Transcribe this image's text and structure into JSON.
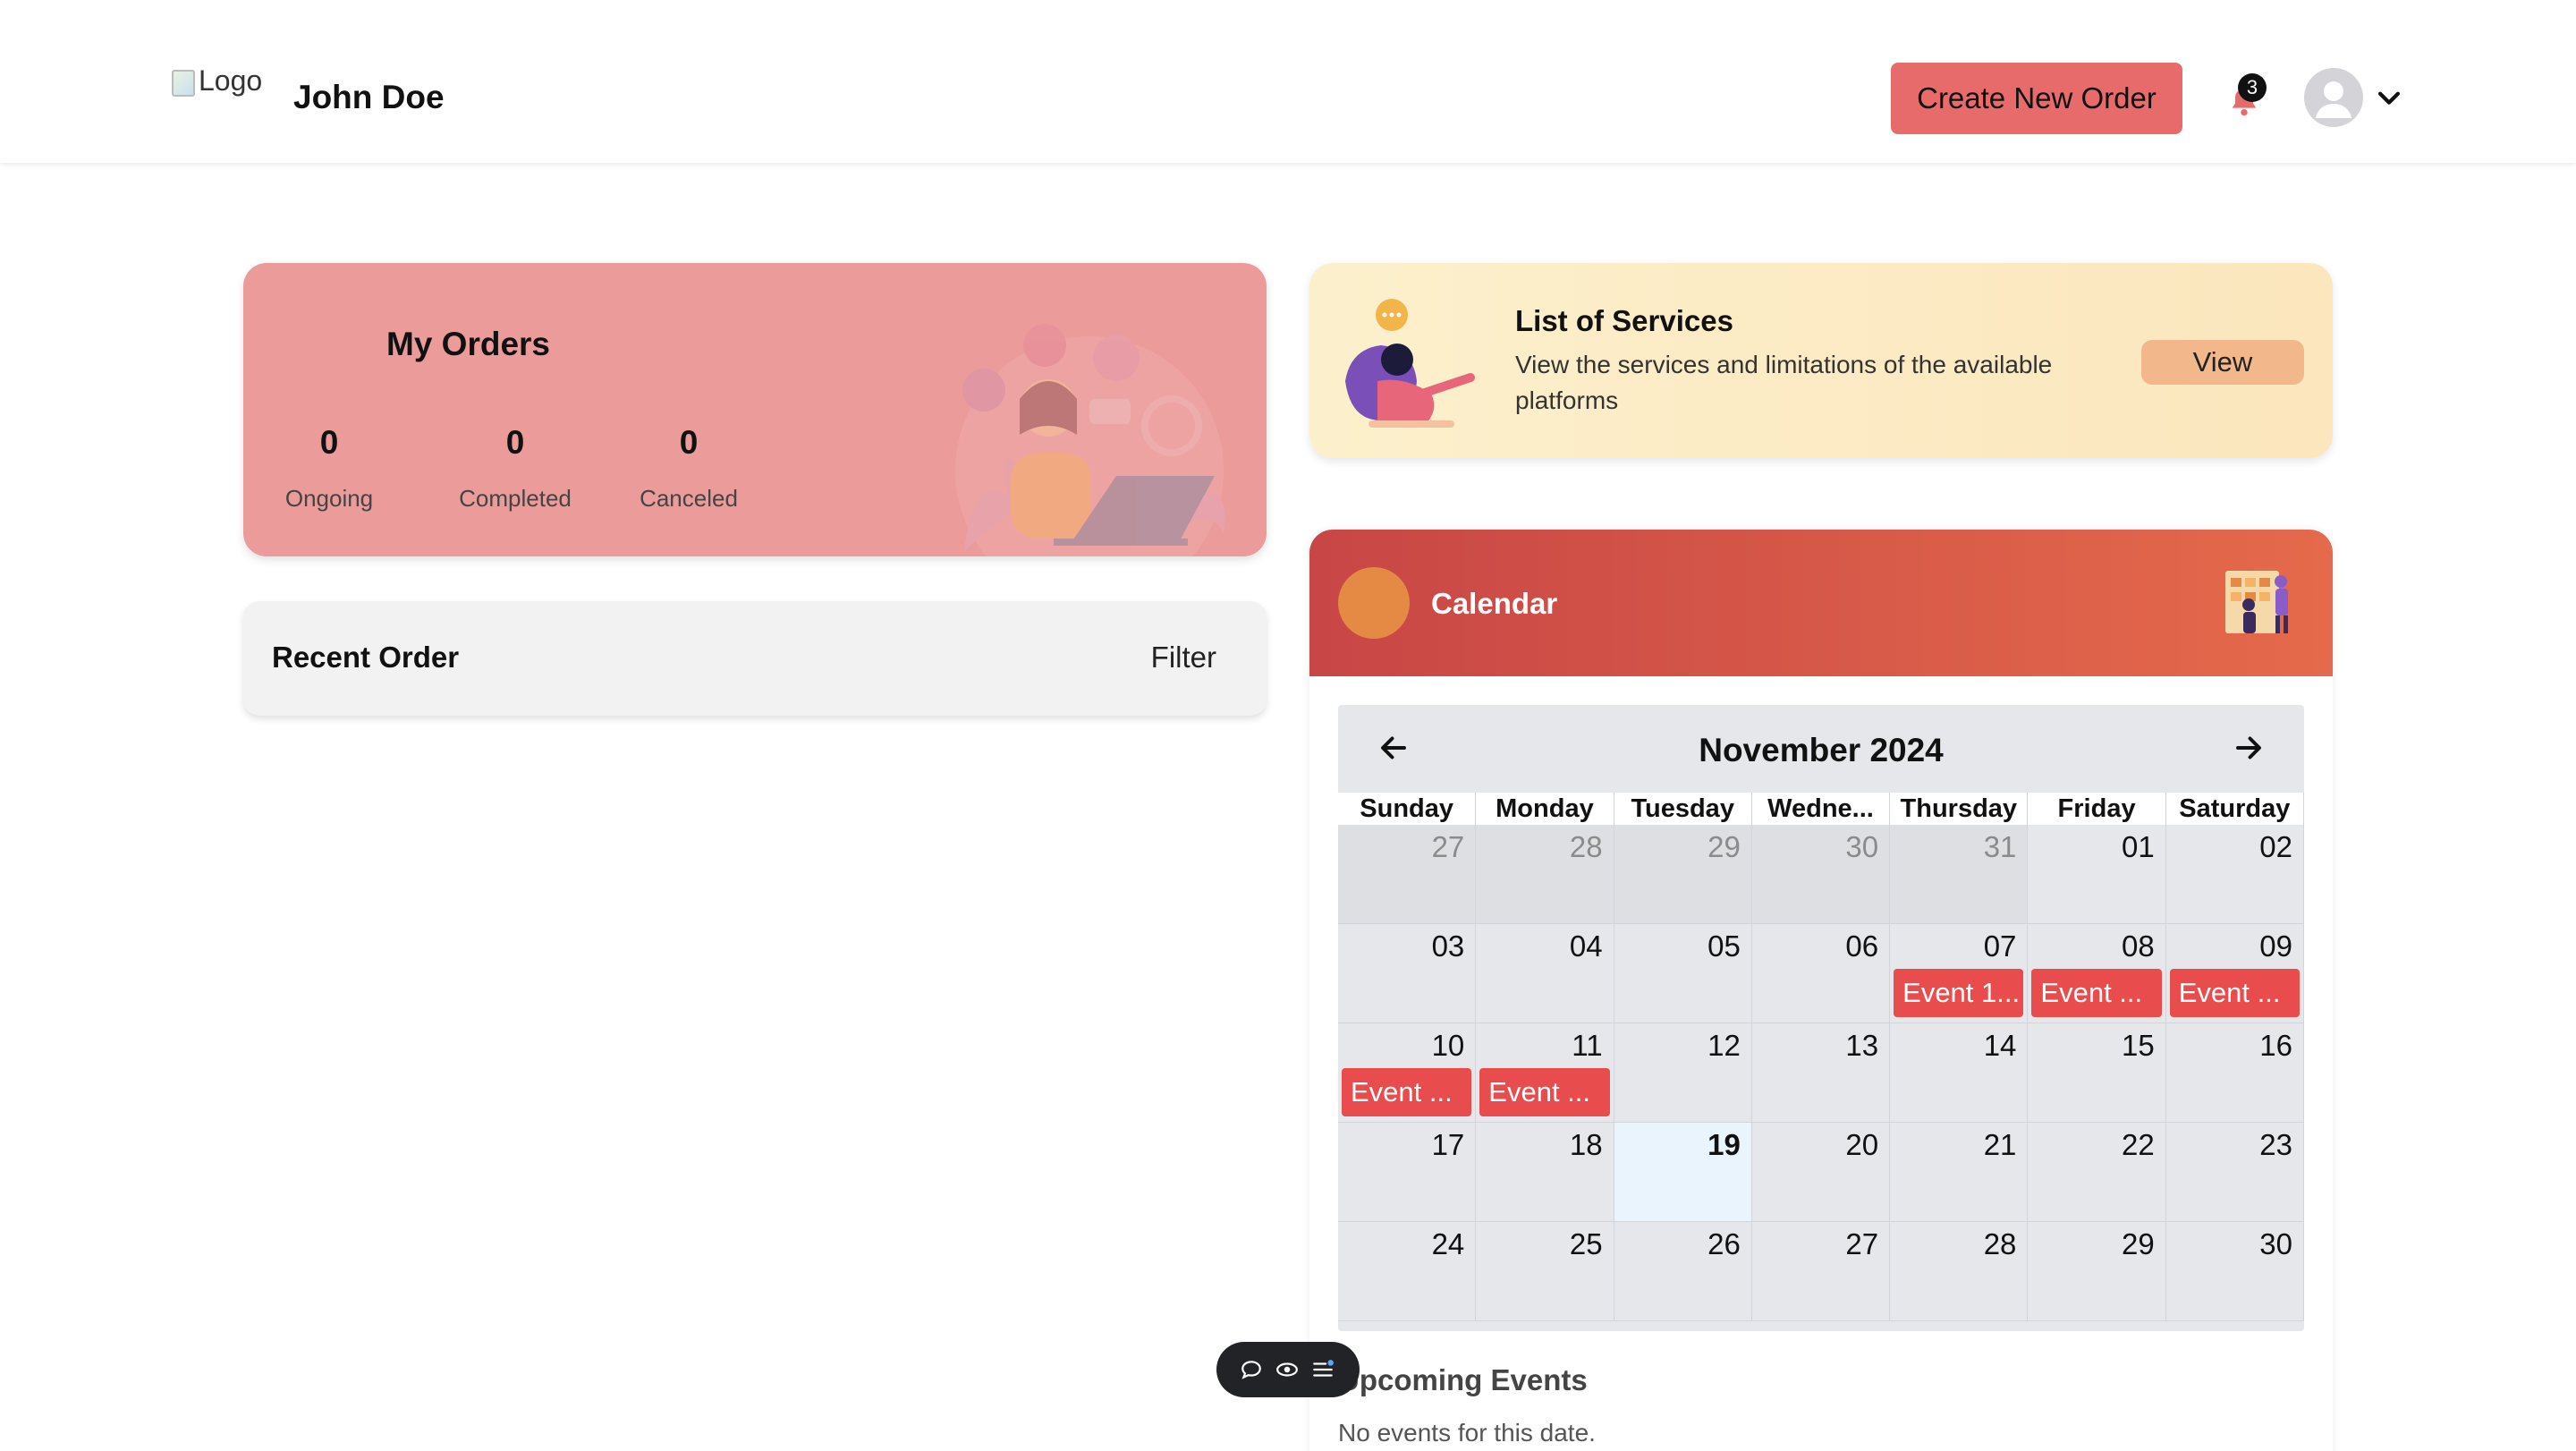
{
  "header": {
    "logo_alt": "Logo",
    "username": "John Doe",
    "create_button": "Create New Order",
    "notification_count": "3"
  },
  "orders": {
    "title": "My Orders",
    "stats": [
      {
        "value": "0",
        "label": "Ongoing"
      },
      {
        "value": "0",
        "label": "Completed"
      },
      {
        "value": "0",
        "label": "Canceled"
      }
    ]
  },
  "recent": {
    "title": "Recent Order",
    "filter": "Filter"
  },
  "services": {
    "title": "List of Services",
    "description": "View the services and limitations of the available platforms",
    "view_button": "View"
  },
  "calendar": {
    "title": "Calendar",
    "month": "November 2024",
    "weekdays": [
      "Sunday",
      "Monday",
      "Tuesday",
      "Wedne...",
      "Thursday",
      "Friday",
      "Saturday"
    ],
    "days": [
      {
        "d": "27",
        "other": true
      },
      {
        "d": "28",
        "other": true
      },
      {
        "d": "29",
        "other": true
      },
      {
        "d": "30",
        "other": true
      },
      {
        "d": "31",
        "other": true
      },
      {
        "d": "01"
      },
      {
        "d": "02"
      },
      {
        "d": "03"
      },
      {
        "d": "04"
      },
      {
        "d": "05"
      },
      {
        "d": "06"
      },
      {
        "d": "07",
        "event": "Event 1..."
      },
      {
        "d": "08",
        "event": "Event ..."
      },
      {
        "d": "09",
        "event": "Event ..."
      },
      {
        "d": "10",
        "event": "Event ..."
      },
      {
        "d": "11",
        "event": "Event ..."
      },
      {
        "d": "12"
      },
      {
        "d": "13"
      },
      {
        "d": "14"
      },
      {
        "d": "15"
      },
      {
        "d": "16"
      },
      {
        "d": "17"
      },
      {
        "d": "18"
      },
      {
        "d": "19",
        "today": true
      },
      {
        "d": "20"
      },
      {
        "d": "21"
      },
      {
        "d": "22"
      },
      {
        "d": "23"
      },
      {
        "d": "24"
      },
      {
        "d": "25"
      },
      {
        "d": "26"
      },
      {
        "d": "27"
      },
      {
        "d": "28"
      },
      {
        "d": "29"
      },
      {
        "d": "30"
      }
    ],
    "upcoming_title": "Upcoming Events",
    "upcoming_empty": "No events for this date."
  },
  "colors": {
    "accent": "#e86b6b",
    "orders_card": "#ec9b9b",
    "event": "#e94c4c",
    "calendar_header": "#c84646"
  }
}
